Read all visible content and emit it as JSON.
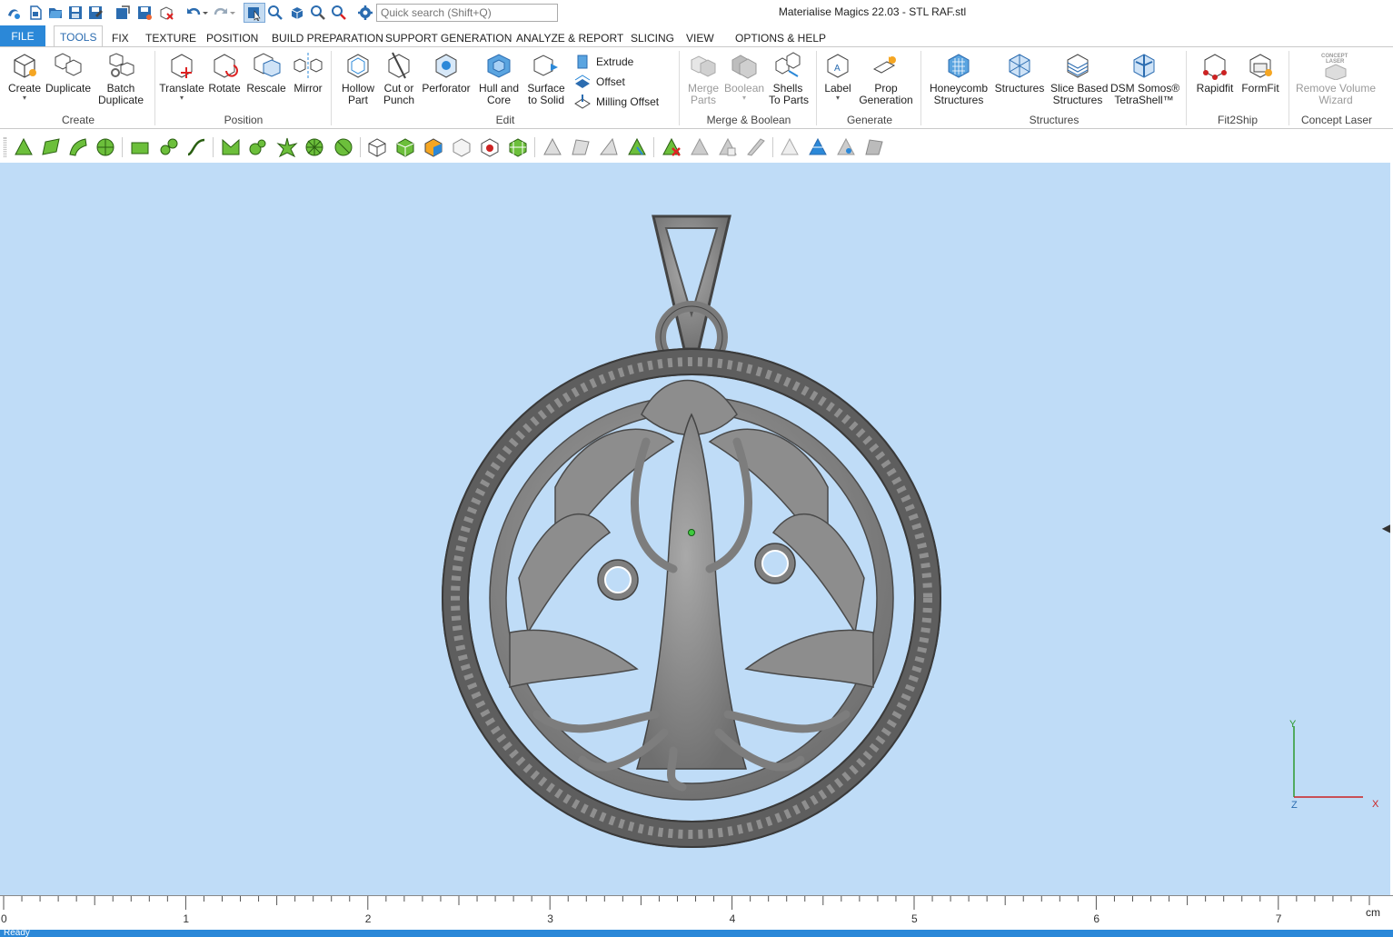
{
  "window": {
    "title": "Materialise Magics 22.03 - STL RAF.stl",
    "quick_search_placeholder": "Quick search (Shift+Q)"
  },
  "ribbon_tabs": [
    {
      "label": "FILE"
    },
    {
      "label": "TOOLS"
    },
    {
      "label": "FIX"
    },
    {
      "label": "TEXTURE"
    },
    {
      "label": "POSITION"
    },
    {
      "label": "BUILD PREPARATION"
    },
    {
      "label": "SUPPORT GENERATION"
    },
    {
      "label": "ANALYZE & REPORT"
    },
    {
      "label": "SLICING"
    },
    {
      "label": "VIEW"
    },
    {
      "label": "OPTIONS & HELP"
    }
  ],
  "ribbon": {
    "create": {
      "group": "Create",
      "create": "Create",
      "duplicate": "Duplicate",
      "batch1": "Batch",
      "batch2": "Duplicate"
    },
    "position": {
      "group": "Position",
      "translate": "Translate",
      "rotate": "Rotate",
      "rescale": "Rescale",
      "mirror": "Mirror"
    },
    "edit": {
      "group": "Edit",
      "hollow1": "Hollow",
      "hollow2": "Part",
      "cut1": "Cut or",
      "cut2": "Punch",
      "perforator": "Perforator",
      "hull1": "Hull and",
      "hull2": "Core",
      "surface1": "Surface",
      "surface2": "to Solid",
      "extrude": "Extrude",
      "offset": "Offset",
      "milling": "Milling Offset"
    },
    "merge": {
      "group": "Merge & Boolean",
      "merge1": "Merge",
      "merge2": "Parts",
      "boolean": "Boolean",
      "shells1": "Shells",
      "shells2": "To Parts"
    },
    "generate": {
      "group": "Generate",
      "label": "Label",
      "prop1": "Prop",
      "prop2": "Generation"
    },
    "structures": {
      "group": "Structures",
      "honey1": "Honeycomb",
      "honey2": "Structures",
      "structures": "Structures",
      "slice1": "Slice Based",
      "slice2": "Structures",
      "dsm1": "DSM Somos®",
      "dsm2": "TetraShell™"
    },
    "fit2ship": {
      "group": "Fit2Ship",
      "rapidfit": "Rapidfit",
      "formfit": "FormFit"
    },
    "concept": {
      "group": "Concept Laser",
      "remove1": "Remove Volume",
      "remove2": "Wizard",
      "logo1": "CONCEPT",
      "logo2": "LASER"
    }
  },
  "viewport": {
    "background": "#bfdcf7",
    "axis": {
      "y": "Y",
      "x": "X",
      "z": "Z"
    }
  },
  "ruler": {
    "labels": [
      "0",
      "1",
      "2",
      "3",
      "4",
      "5",
      "6",
      "7"
    ],
    "unit": "cm"
  },
  "status": {
    "text": "Ready"
  },
  "colors": {
    "accent": "#2b88d8",
    "model": "#8a8a8a",
    "viewport": "#bfdcf7"
  }
}
